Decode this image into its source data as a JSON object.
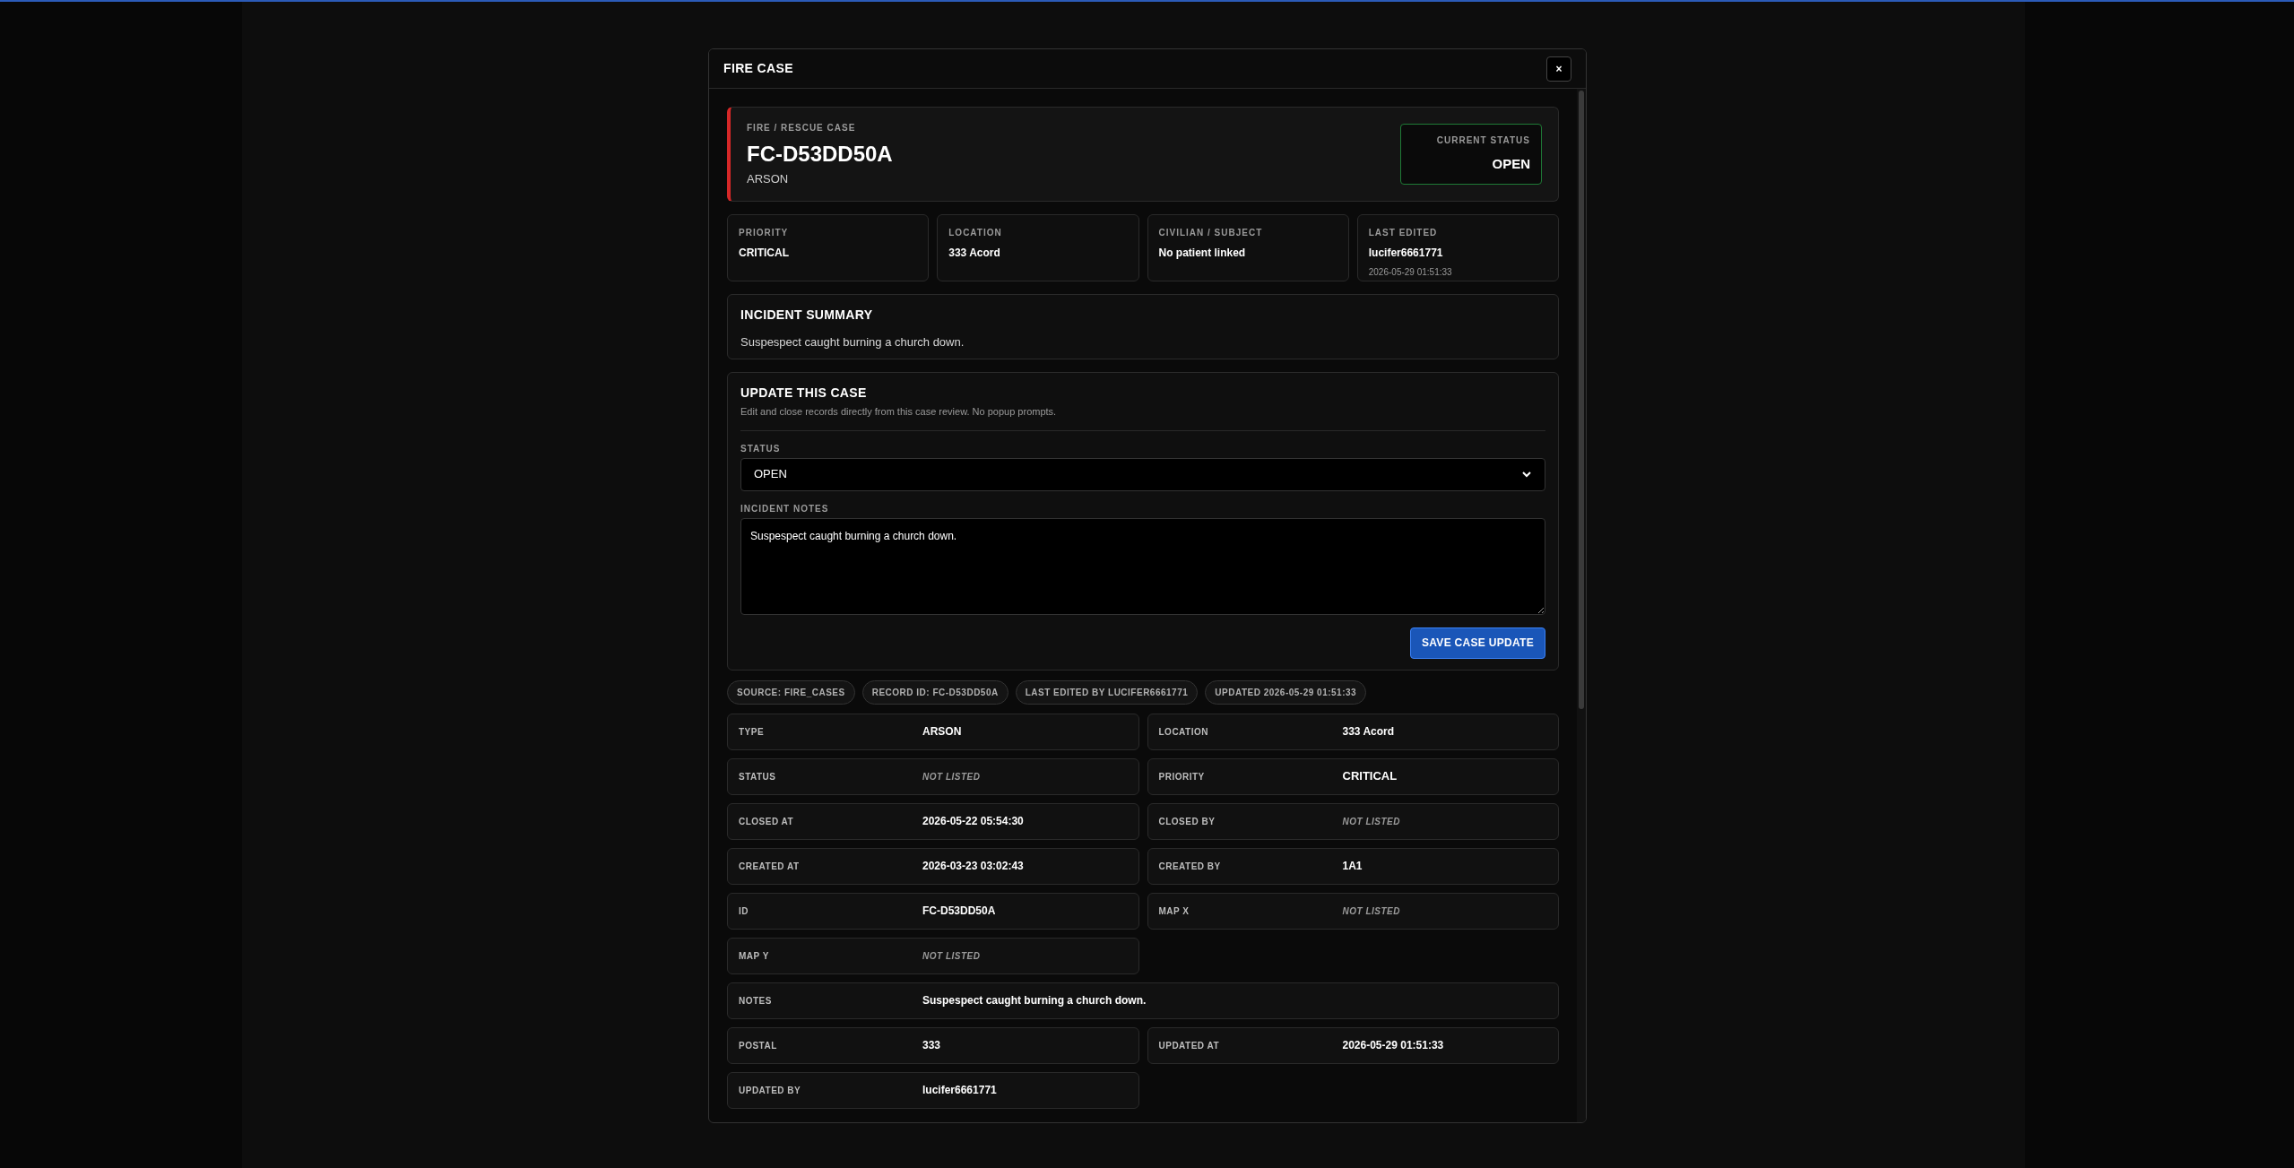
{
  "modal": {
    "title": "FIRE CASE",
    "close": "×"
  },
  "hero": {
    "eyebrow": "FIRE / RESCUE CASE",
    "case_id": "FC-D53DD50A",
    "type": "ARSON",
    "status_label": "CURRENT STATUS",
    "status": "OPEN"
  },
  "summary_cards": [
    {
      "label": "PRIORITY",
      "value": "CRITICAL"
    },
    {
      "label": "LOCATION",
      "value": "333 Acord"
    },
    {
      "label": "CIVILIAN / SUBJECT",
      "value": "No patient linked"
    },
    {
      "label": "LAST EDITED",
      "value": "lucifer6661771",
      "sub": "2026-05-29 01:51:33"
    }
  ],
  "incident_summary": {
    "title": "INCIDENT SUMMARY",
    "text": "Suspespect caught burning a church down."
  },
  "update": {
    "title": "UPDATE THIS CASE",
    "subtitle": "Edit and close records directly from this case review. No popup prompts.",
    "status_label": "STATUS",
    "status_value": "OPEN",
    "notes_label": "INCIDENT NOTES",
    "notes_value": "Suspespect caught burning a church down.",
    "save": "SAVE CASE UPDATE"
  },
  "chips": [
    "SOURCE: FIRE_CASES",
    "RECORD ID: FC-D53DD50A",
    "LAST EDITED BY LUCIFER6661771",
    "UPDATED 2026-05-29 01:51:33"
  ],
  "details": [
    {
      "label": "TYPE",
      "value": "ARSON",
      "kind": "value"
    },
    {
      "label": "LOCATION",
      "value": "333 Acord",
      "kind": "value"
    },
    {
      "label": "STATUS",
      "value": "NOT LISTED",
      "kind": "missing"
    },
    {
      "label": "PRIORITY",
      "value": "CRITICAL",
      "kind": "emphasis"
    },
    {
      "label": "CLOSED AT",
      "value": "2026-05-22 05:54:30",
      "kind": "value"
    },
    {
      "label": "CLOSED BY",
      "value": "NOT LISTED",
      "kind": "missing"
    },
    {
      "label": "CREATED AT",
      "value": "2026-03-23 03:02:43",
      "kind": "value"
    },
    {
      "label": "CREATED BY",
      "value": "1A1",
      "kind": "value"
    },
    {
      "label": "ID",
      "value": "FC-D53DD50A",
      "kind": "value"
    },
    {
      "label": "MAP X",
      "value": "NOT LISTED",
      "kind": "missing"
    },
    {
      "label": "MAP Y",
      "value": "NOT LISTED",
      "kind": "missing"
    },
    {
      "label": "NOTES",
      "value": "Suspespect caught burning a church down.",
      "kind": "wide"
    },
    {
      "label": "POSTAL",
      "value": "333",
      "kind": "value"
    },
    {
      "label": "UPDATED AT",
      "value": "2026-05-29 01:51:33",
      "kind": "value"
    },
    {
      "label": "UPDATED BY",
      "value": "lucifer6661771",
      "kind": "value"
    }
  ]
}
